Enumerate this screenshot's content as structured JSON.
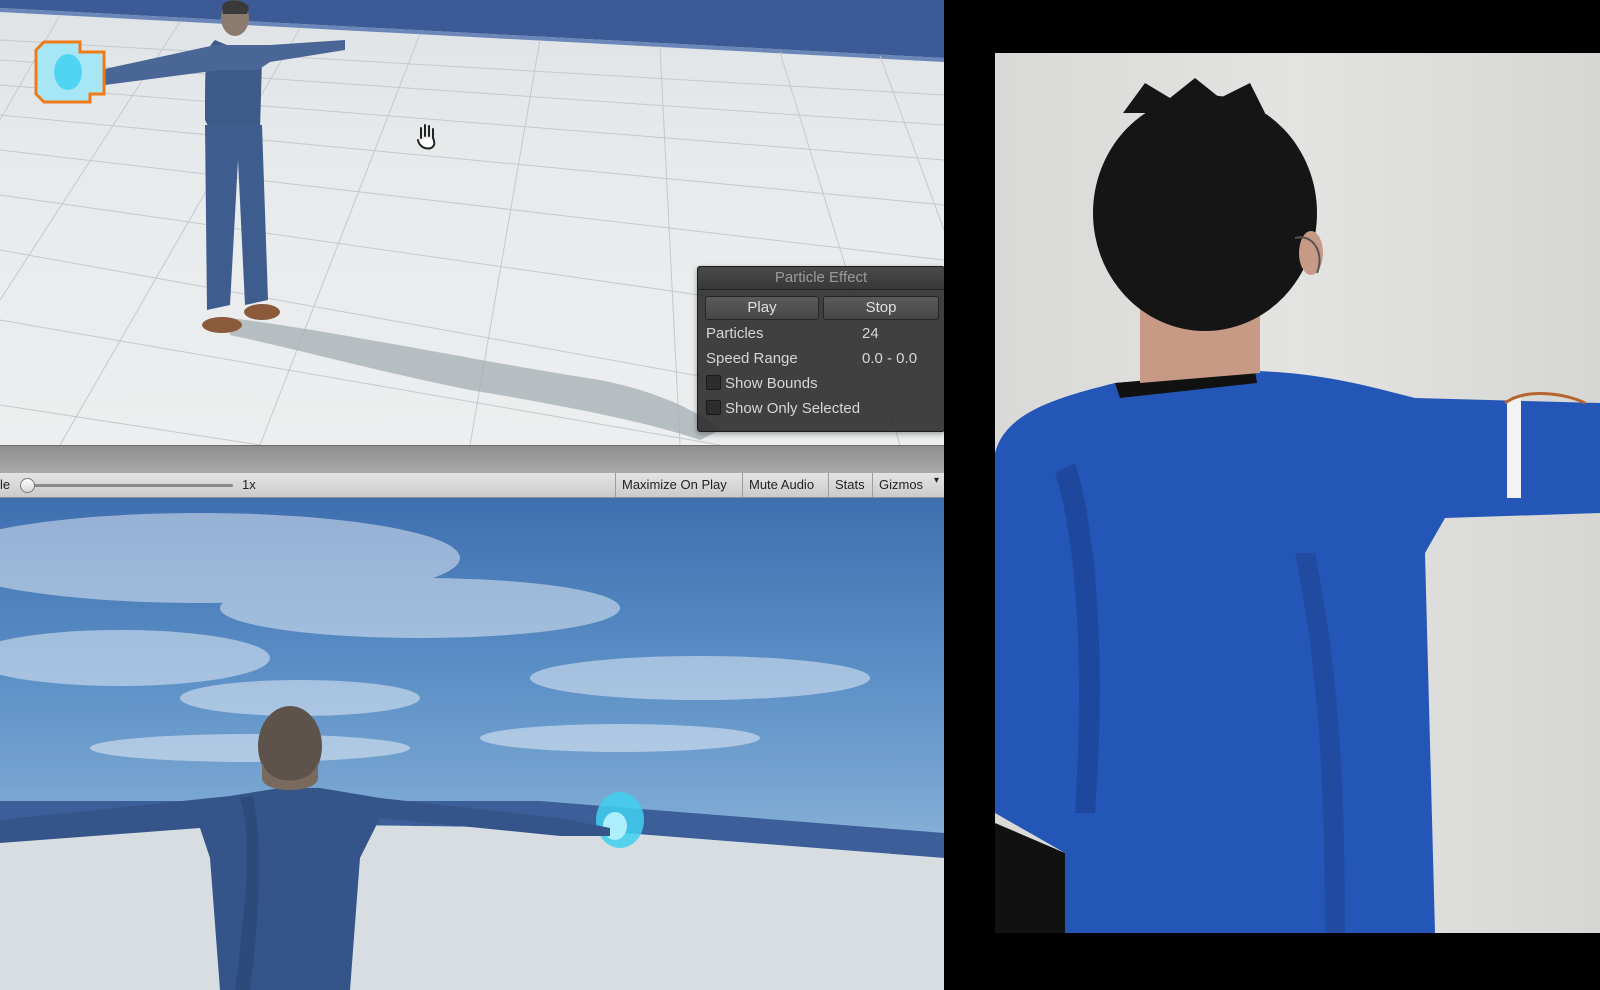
{
  "particle_effect": {
    "title": "Particle Effect",
    "play_label": "Play",
    "stop_label": "Stop",
    "particles_label": "Particles",
    "particles_value": "24",
    "speed_range_label": "Speed Range",
    "speed_range_value": "0.0 - 0.0",
    "show_bounds_label": "Show Bounds",
    "show_only_selected_label": "Show Only Selected"
  },
  "game_toolbar": {
    "scale_label": "le",
    "scale_value": "1x",
    "maximize_on_play": "Maximize On Play",
    "mute_audio": "Mute Audio",
    "stats": "Stats",
    "gizmos": "Gizmos"
  },
  "icons": {
    "scene_pan": "hand-icon",
    "particle_gizmo": "particle-system-icon"
  },
  "colors": {
    "gizmo_orange": "#f07a1a",
    "particle_cyan": "#3fd0f0",
    "shirt_blue": "#2456b8"
  }
}
